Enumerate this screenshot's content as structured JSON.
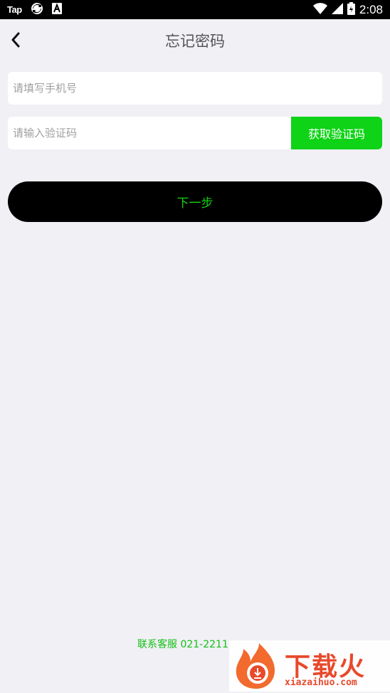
{
  "status_bar": {
    "tap_label": "Tap",
    "time": "2:08"
  },
  "header": {
    "title": "忘记密码"
  },
  "form": {
    "phone_placeholder": "请填写手机号",
    "code_placeholder": "请输入验证码",
    "get_code_label": "获取验证码",
    "next_label": "下一步"
  },
  "footer": {
    "contact": "联系客服 021-2211"
  },
  "watermark": {
    "brand_text": "下载火",
    "brand_url": "xiazaihuo.com"
  },
  "colors": {
    "accent_green": "#0ed316",
    "button_black": "#000000",
    "background": "#f0f0f5",
    "watermark_orange": "#e8492b"
  }
}
